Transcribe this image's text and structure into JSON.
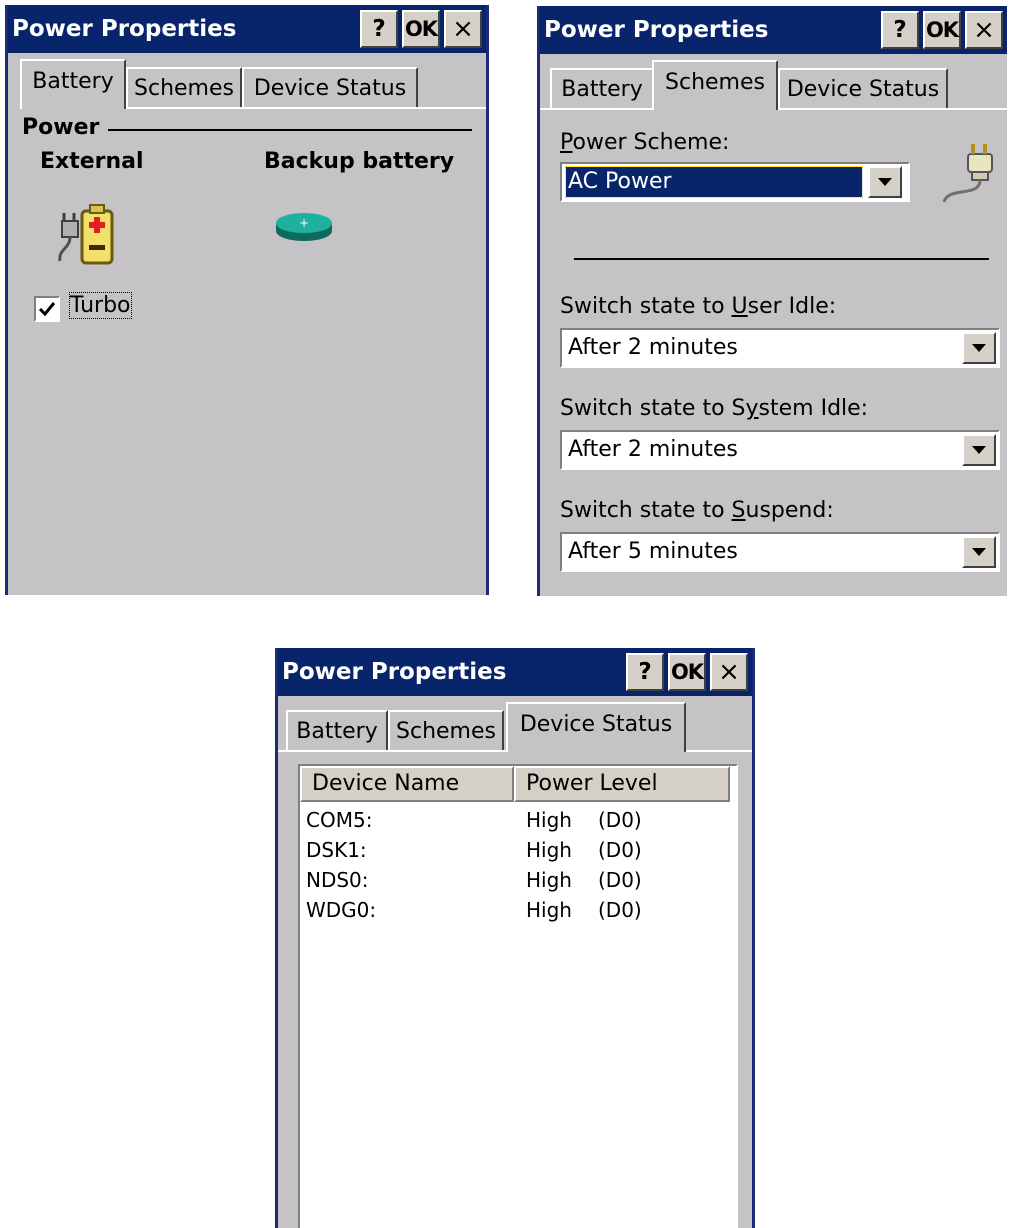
{
  "windows": [
    {
      "title": "Power Properties",
      "buttons": {
        "help": "?",
        "ok": "OK",
        "close": "×"
      },
      "tabs": [
        "Battery",
        "Schemes",
        "Device Status"
      ],
      "active_tab": "Battery"
    },
    {
      "title": "Power Properties",
      "buttons": {
        "help": "?",
        "ok": "OK",
        "close": "×"
      },
      "tabs": [
        "Battery",
        "Schemes",
        "Device Status"
      ],
      "active_tab": "Schemes"
    },
    {
      "title": "Power Properties",
      "buttons": {
        "help": "?",
        "ok": "OK",
        "close": "×"
      },
      "tabs": [
        "Battery",
        "Schemes",
        "Device Status"
      ],
      "active_tab": "Device Status"
    }
  ],
  "battery": {
    "group_label": "Power",
    "external_label": "External",
    "backup_label": "Backup battery",
    "turbo": {
      "label": "Turbo",
      "checked": true
    }
  },
  "schemes": {
    "power_scheme": {
      "label_key": "P",
      "label_rest": "ower Scheme:",
      "value": "AC Power"
    },
    "user_idle": {
      "label_pre": "Switch state to ",
      "label_key": "U",
      "label_post": "ser Idle:",
      "value": "After 2 minutes"
    },
    "system_idle": {
      "label_pre": "Switch state to S",
      "label_key": "y",
      "label_post": "stem Idle:",
      "value": "After 2 minutes"
    },
    "suspend": {
      "label_pre": "Switch state to ",
      "label_key": "S",
      "label_post": "uspend:",
      "value": "After 5 minutes"
    }
  },
  "device_status": {
    "columns": [
      "Device Name",
      "Power Level"
    ],
    "rows": [
      {
        "device": "COM5:",
        "level": "High",
        "state": "(D0)"
      },
      {
        "device": "DSK1:",
        "level": "High",
        "state": "(D0)"
      },
      {
        "device": "NDS0:",
        "level": "High",
        "state": "(D0)"
      },
      {
        "device": "WDG0:",
        "level": "High",
        "state": "(D0)"
      }
    ]
  },
  "colors": {
    "titlebar": "#08246b",
    "window_bg": "#c6c3c6"
  }
}
